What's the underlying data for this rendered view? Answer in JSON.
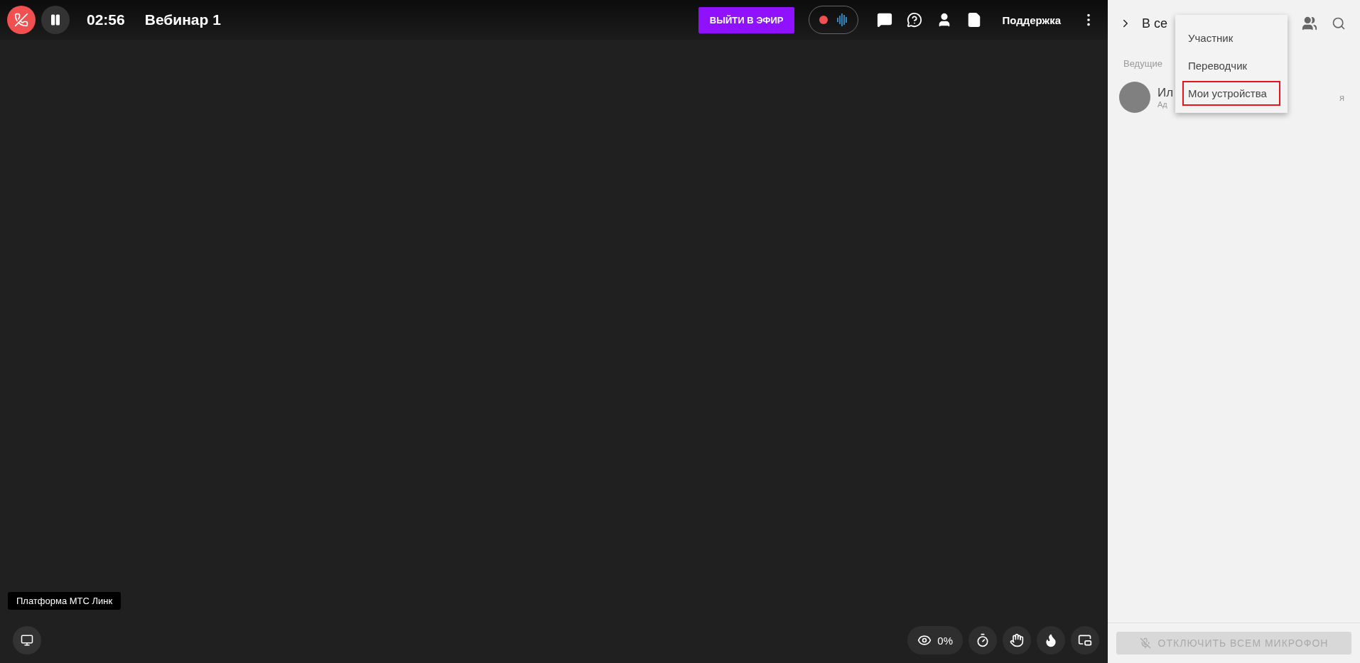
{
  "top_bar": {
    "timer": "02:56",
    "title": "Вебинар 1",
    "live_button": "ВЫЙТИ В ЭФИР",
    "recording": true,
    "support": "Поддержка"
  },
  "sidebar": {
    "title": "В се",
    "section": "Ведущие",
    "participants": [
      {
        "name": "Ил",
        "role": "Ад",
        "me": "я"
      }
    ],
    "mute_all": {
      "label": "ОТКЛЮЧИТЬ ВСЕМ МИКРОФОН",
      "disabled": true
    }
  },
  "menu": [
    {
      "label": "Участник",
      "selected": false
    },
    {
      "label": "Переводчик",
      "selected": false
    },
    {
      "label": "Мои устройства",
      "selected": true
    }
  ],
  "tooltip": "Платформа МТС Линк",
  "bottom_bar": {
    "views": "0%"
  }
}
